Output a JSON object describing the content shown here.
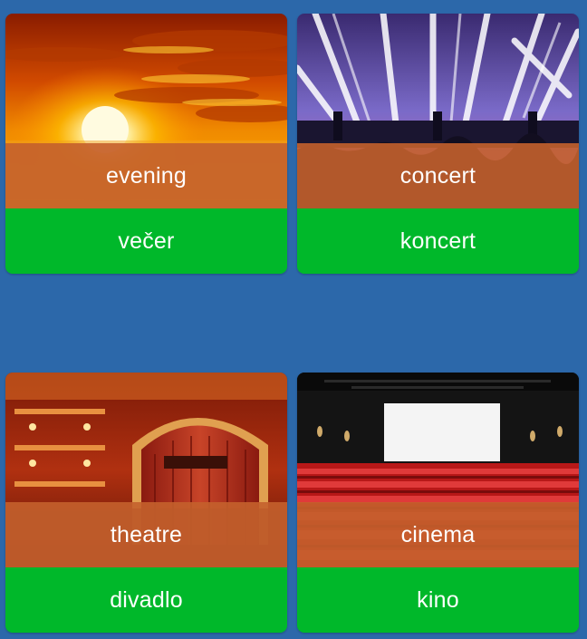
{
  "cards": [
    {
      "image_icon": "sunset-photo-icon",
      "english": "evening",
      "translation": "večer"
    },
    {
      "image_icon": "concert-stage-photo-icon",
      "english": "concert",
      "translation": "koncert"
    },
    {
      "image_icon": "theatre-stage-photo-icon",
      "english": "theatre",
      "translation": "divadlo"
    },
    {
      "image_icon": "cinema-screen-photo-icon",
      "english": "cinema",
      "translation": "kino"
    }
  ],
  "colors": {
    "background": "#2c68aa",
    "caption_overlay": "#c4602c",
    "answer_bar": "#00b82a",
    "text": "#ffffff"
  }
}
